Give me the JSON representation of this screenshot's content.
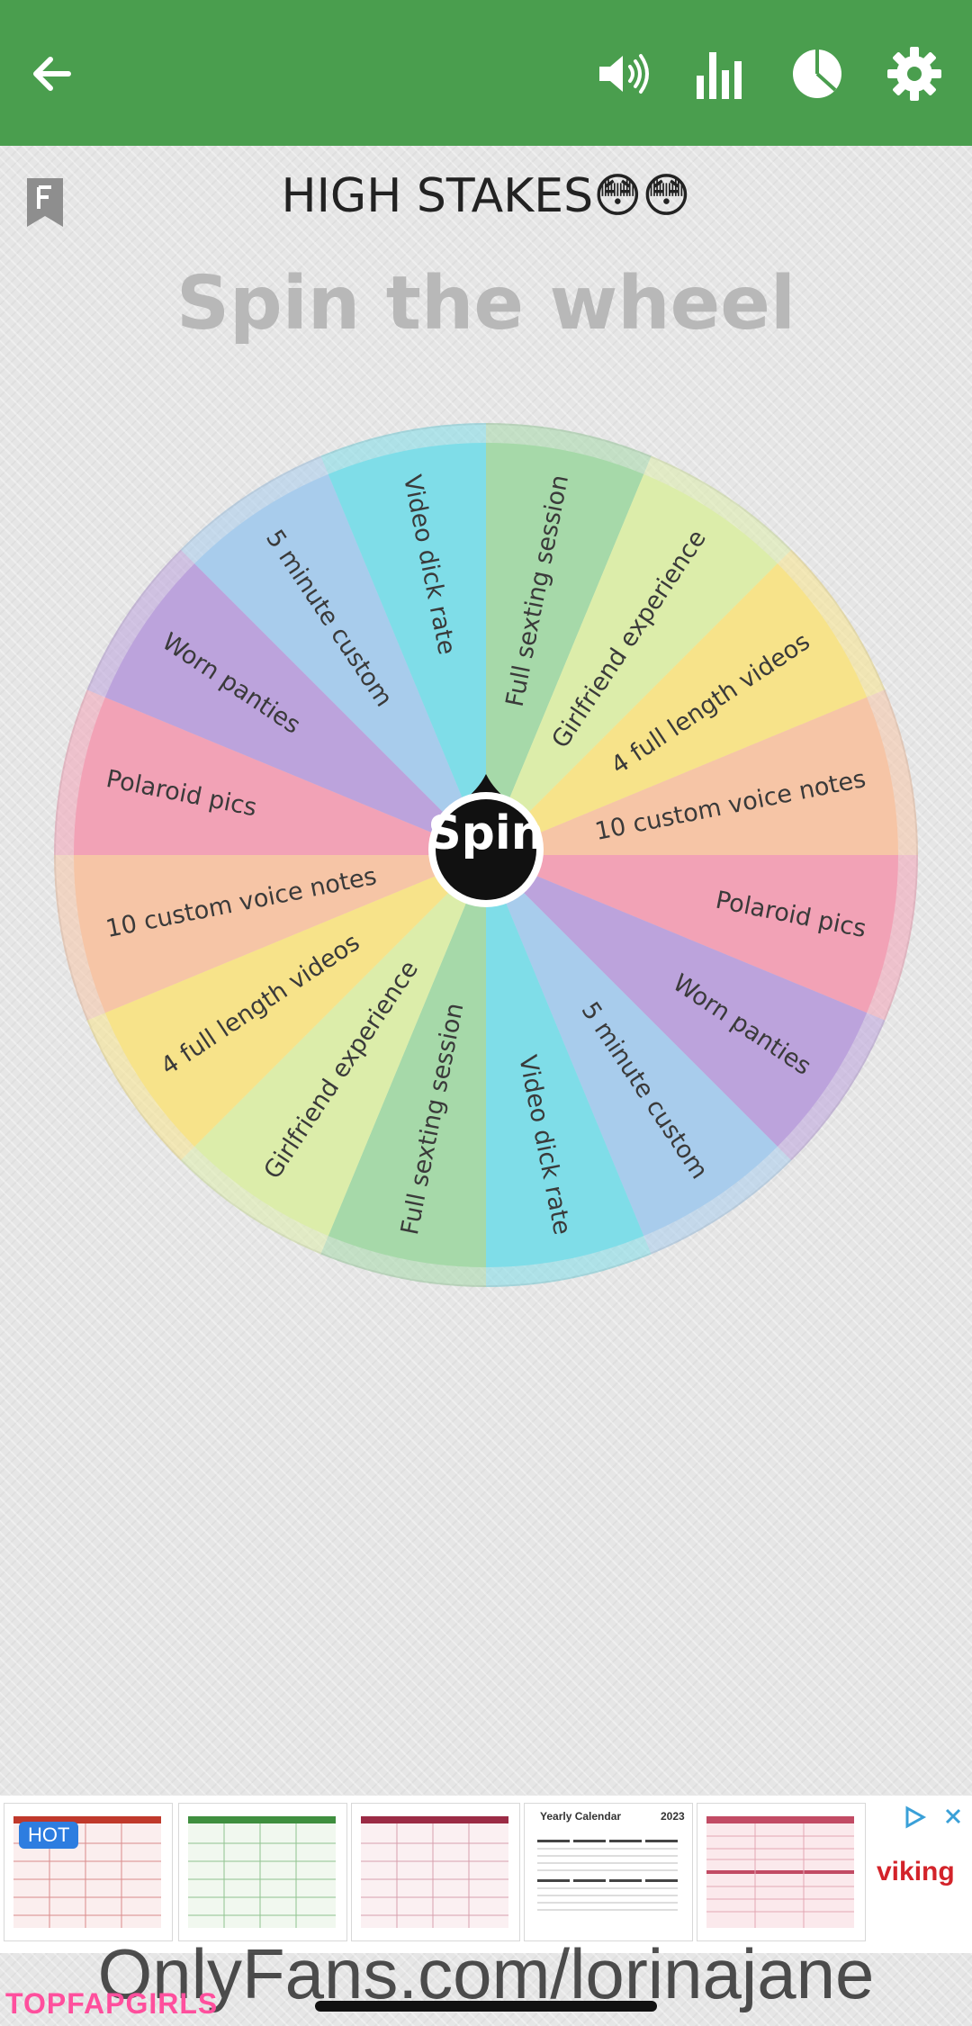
{
  "header": {
    "back_icon": "arrow-left-icon",
    "sound_icon": "volume-icon",
    "stats_icon": "bar-chart-icon",
    "results_icon": "pie-chart-icon",
    "settings_icon": "gear-icon",
    "background_color": "#4a9e4e"
  },
  "bookmark_icon": "bookmark-f-icon",
  "title": "HIGH STAKES😳😳",
  "subtitle": "Spin the wheel",
  "wheel": {
    "spin_label": "Spin",
    "segments": [
      {
        "label": "Full sexting session",
        "color": "#a6d9a9"
      },
      {
        "label": "Girlfriend experience",
        "color": "#dcedaa"
      },
      {
        "label": "4 full length videos",
        "color": "#f7e38a"
      },
      {
        "label": "10 custom voice notes",
        "color": "#f6c5a6"
      },
      {
        "label": "Polaroid pics",
        "color": "#f2a2b6"
      },
      {
        "label": "Worn panties",
        "color": "#bca3dc"
      },
      {
        "label": "5 minute custom",
        "color": "#a8ccec"
      },
      {
        "label": "Video dick rate",
        "color": "#7fdde8"
      },
      {
        "label": "Full sexting session",
        "color": "#a6d9a9"
      },
      {
        "label": "Girlfriend experience",
        "color": "#dcedaa"
      },
      {
        "label": "4 full length videos",
        "color": "#f7e38a"
      },
      {
        "label": "10 custom voice notes",
        "color": "#f6c5a6"
      },
      {
        "label": "Polaroid pics",
        "color": "#f2a2b6"
      },
      {
        "label": "Worn panties",
        "color": "#bca3dc"
      },
      {
        "label": "5 minute custom",
        "color": "#a8ccec"
      },
      {
        "label": "Video dick rate",
        "color": "#7fdde8"
      }
    ]
  },
  "ad": {
    "badge": "HOT",
    "calendar_title": "Yearly Calendar",
    "calendar_year": "2023",
    "brand": "viking",
    "adchoices_icon": "ad-choices-close-icon"
  },
  "watermark": "OnlyFans.com/lorinajane",
  "watermark_site": "TOPFAPGIRLS"
}
